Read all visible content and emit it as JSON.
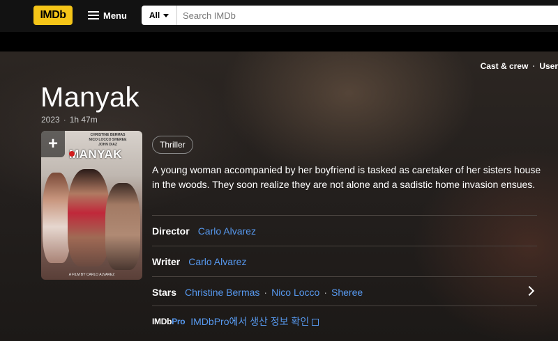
{
  "nav": {
    "logo": "IMDb",
    "menu_label": "Menu",
    "search_category": "All",
    "search_placeholder": "Search IMDb"
  },
  "top_links": [
    "Cast & crew",
    "User"
  ],
  "movie": {
    "title": "Manyak",
    "year": "2023",
    "runtime": "1h 47m",
    "genre": "Thriller",
    "plot": "A young woman accompanied by her boyfriend is tasked as caretaker of her sisters house in the woods. They soon realize they are not alone and a sadistic home invasion ensues.",
    "director_label": "Director",
    "director": "Carlo Alvarez",
    "writer_label": "Writer",
    "writer": "Carlo Alvarez",
    "stars_label": "Stars",
    "stars": [
      "Christine Bermas",
      "Nico Locco",
      "Sheree"
    ]
  },
  "poster": {
    "title_text": "MANYAK",
    "cast_text": "CHRISTINE BERMAS",
    "cast_sub": "NICO LOCCO   SHEREE",
    "cast_sub2": "JOHN DIAZ",
    "foot_text": "A FILM BY CARLO ALVAREZ"
  },
  "imdbpro": {
    "logo_a": "IMDb",
    "logo_b": "Pro",
    "link_text": "IMDbPro에서 생산 정보 확인"
  },
  "colors": {
    "imdb_yellow": "#f5c518",
    "link_blue": "#5799ef"
  }
}
